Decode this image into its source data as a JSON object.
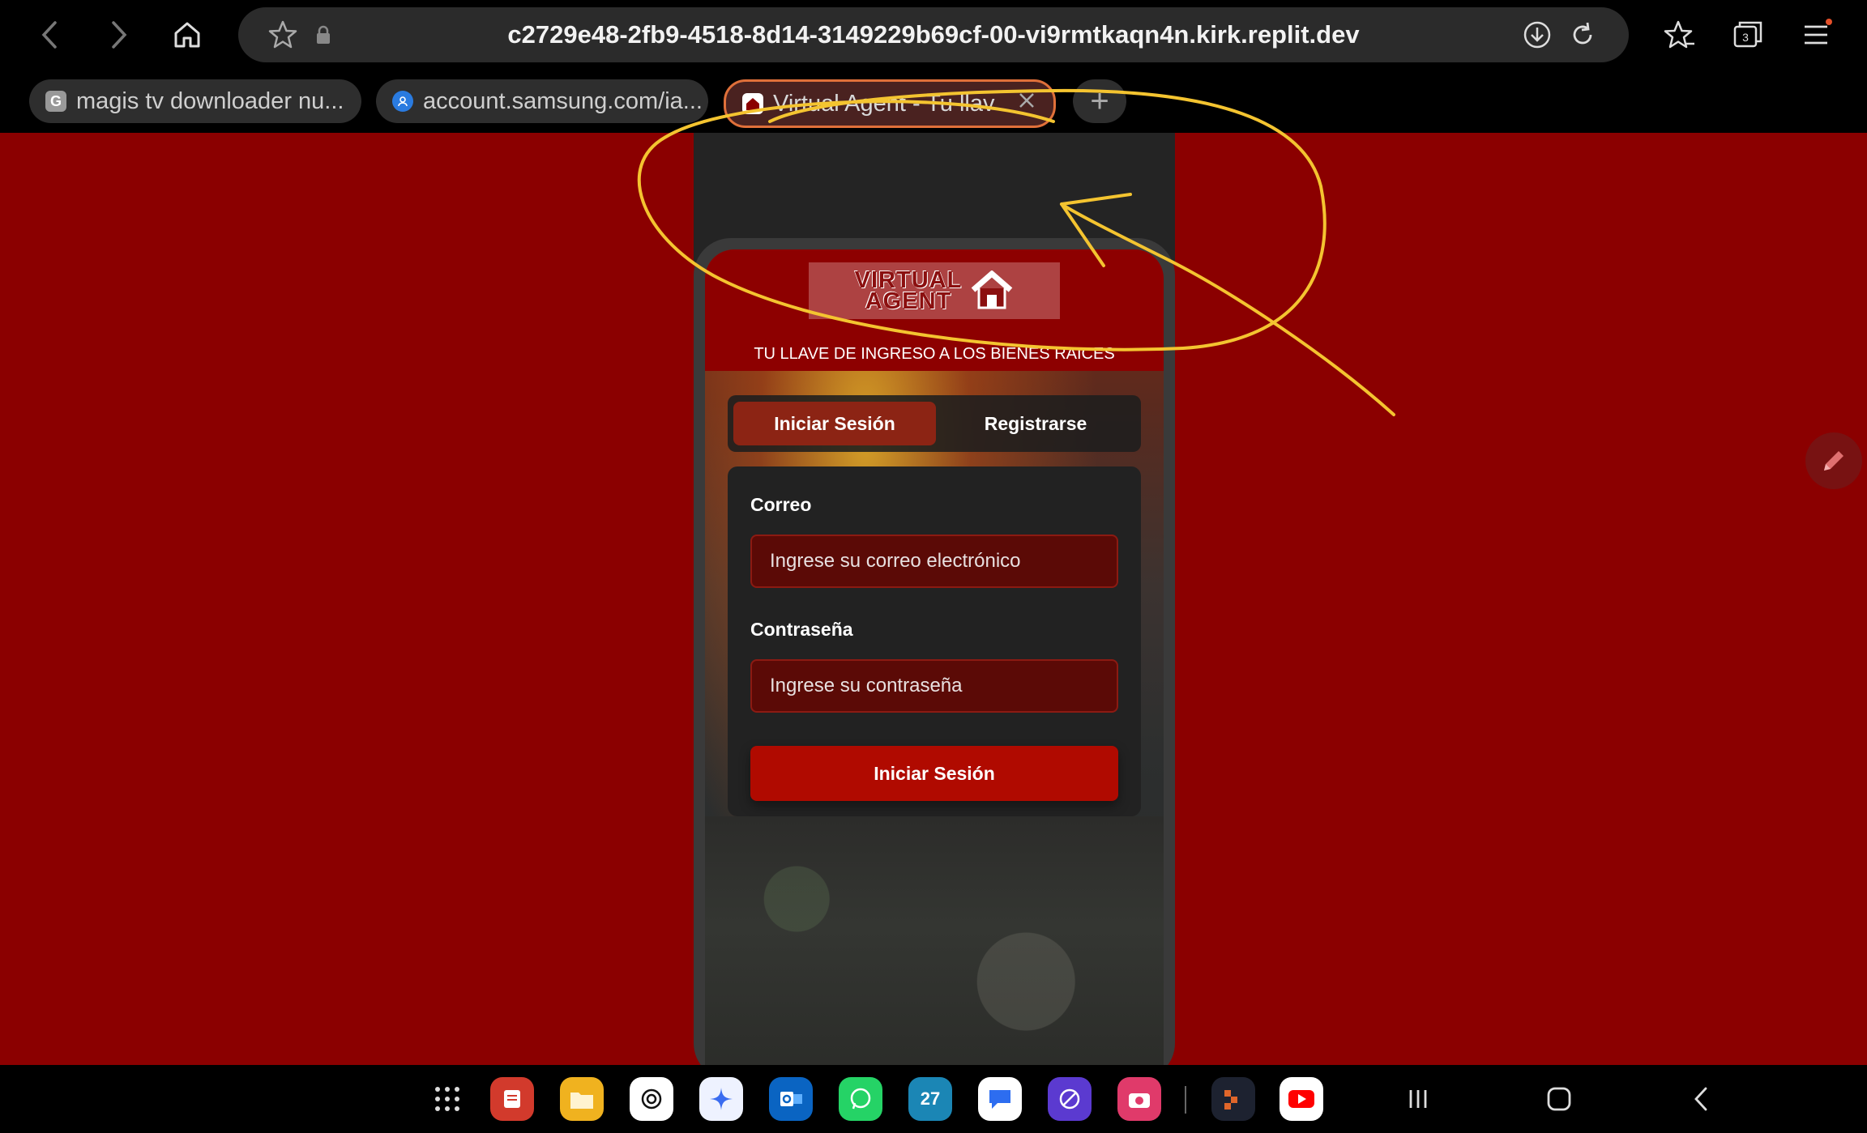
{
  "browser": {
    "url": "c2729e48-2fb9-4518-8d14-3149229b69cf-00-vi9rmtkaqn4n.kirk.replit.dev",
    "tab_count": "3",
    "tabs": [
      {
        "label": "magis tv downloader nu...",
        "favicon": "G"
      },
      {
        "label": "account.samsung.com/ia...",
        "favicon": "samsung-account-icon"
      },
      {
        "label": "Virtual Agent - Tu llav",
        "favicon": "house-icon",
        "active": true
      }
    ]
  },
  "app": {
    "logo_line1": "VIRTUAL",
    "logo_line2": "AGENT",
    "logo_sub": "TU LLAVE DE INGRESO A LOS BIENES RAICES",
    "tagline": "TU LLAVE DE INGRESO A LOS BIENES RAICES",
    "tabs": {
      "login": "Iniciar Sesión",
      "register": "Registrarse"
    },
    "form": {
      "email_label": "Correo",
      "email_placeholder": "Ingrese su correo electrónico",
      "password_label": "Contraseña",
      "password_placeholder": "Ingrese su contraseña",
      "submit": "Iniciar Sesión"
    }
  },
  "taskbar": {
    "calendar_day": "27"
  },
  "colors": {
    "page_bg": "#8b0000",
    "primary_button": "#b00a00",
    "annotation": "#f4c430"
  }
}
